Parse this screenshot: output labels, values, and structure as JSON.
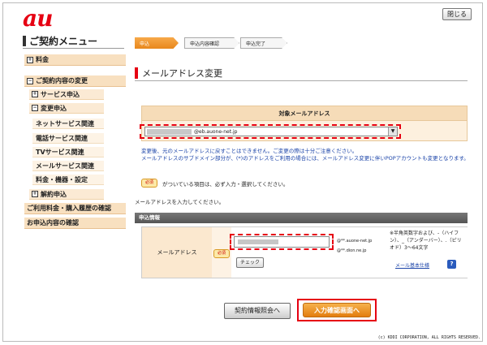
{
  "logo": "au",
  "close_label": "閉じる",
  "sidebar": {
    "title": "ご契約メニュー",
    "items": [
      {
        "label": "料金",
        "toggle": "+"
      },
      {
        "label": "ご契約内容の変更",
        "toggle": "−"
      },
      {
        "label": "サービス申込",
        "toggle": "+"
      },
      {
        "label": "変更申込",
        "toggle": "−"
      },
      {
        "label": "ネットサービス関連"
      },
      {
        "label": "電話サービス関連"
      },
      {
        "label": "TVサービス関連"
      },
      {
        "label": "メールサービス関連"
      },
      {
        "label": "料金・機器・設定"
      },
      {
        "label": "解約申込",
        "toggle": "+"
      },
      {
        "label": "ご利用料金・購入履歴の確認"
      },
      {
        "label": "お申込内容の確認"
      }
    ]
  },
  "steps": [
    "申込",
    "申込内容確認",
    "申込完了"
  ],
  "page_title": "メールアドレス変更",
  "target": {
    "header": "対象メールアドレス",
    "selected": "@eb.auone-net.jp",
    "arrow": "▼"
  },
  "notice": {
    "line1": "変更後、元のメールアドレスに戻すことはできません。ご変更の際は十分ご注意ください。",
    "line2": "メールアドレスのサブドメイン部分が、(*)のアドレスをご利用の場合には、メールアドレス変更に伴いPOPアカウントも変更となります。"
  },
  "required_badge": "必須",
  "required_note": "がついている項目は、必ず入力・選択してください。",
  "instruction": "メールアドレスを入力してください。",
  "section_header": "申込情報",
  "form": {
    "label": "メールアドレス",
    "domain1": "@**.auone-net.jp",
    "domain2": "@**.dion.ne.jp",
    "check_label": "チェック",
    "hint": "※半角英数字および、-（ハイフン）、_（アンダーバー）、.（ピリオド）3〜64文字",
    "spec_link": "メール基本仕様",
    "help": "?"
  },
  "buttons": {
    "back": "契約情報照会へ",
    "next": "入力確認画面へ"
  },
  "copyright": "(c) KDDI CORPORATION, ALL RIGHTS RESERVED."
}
